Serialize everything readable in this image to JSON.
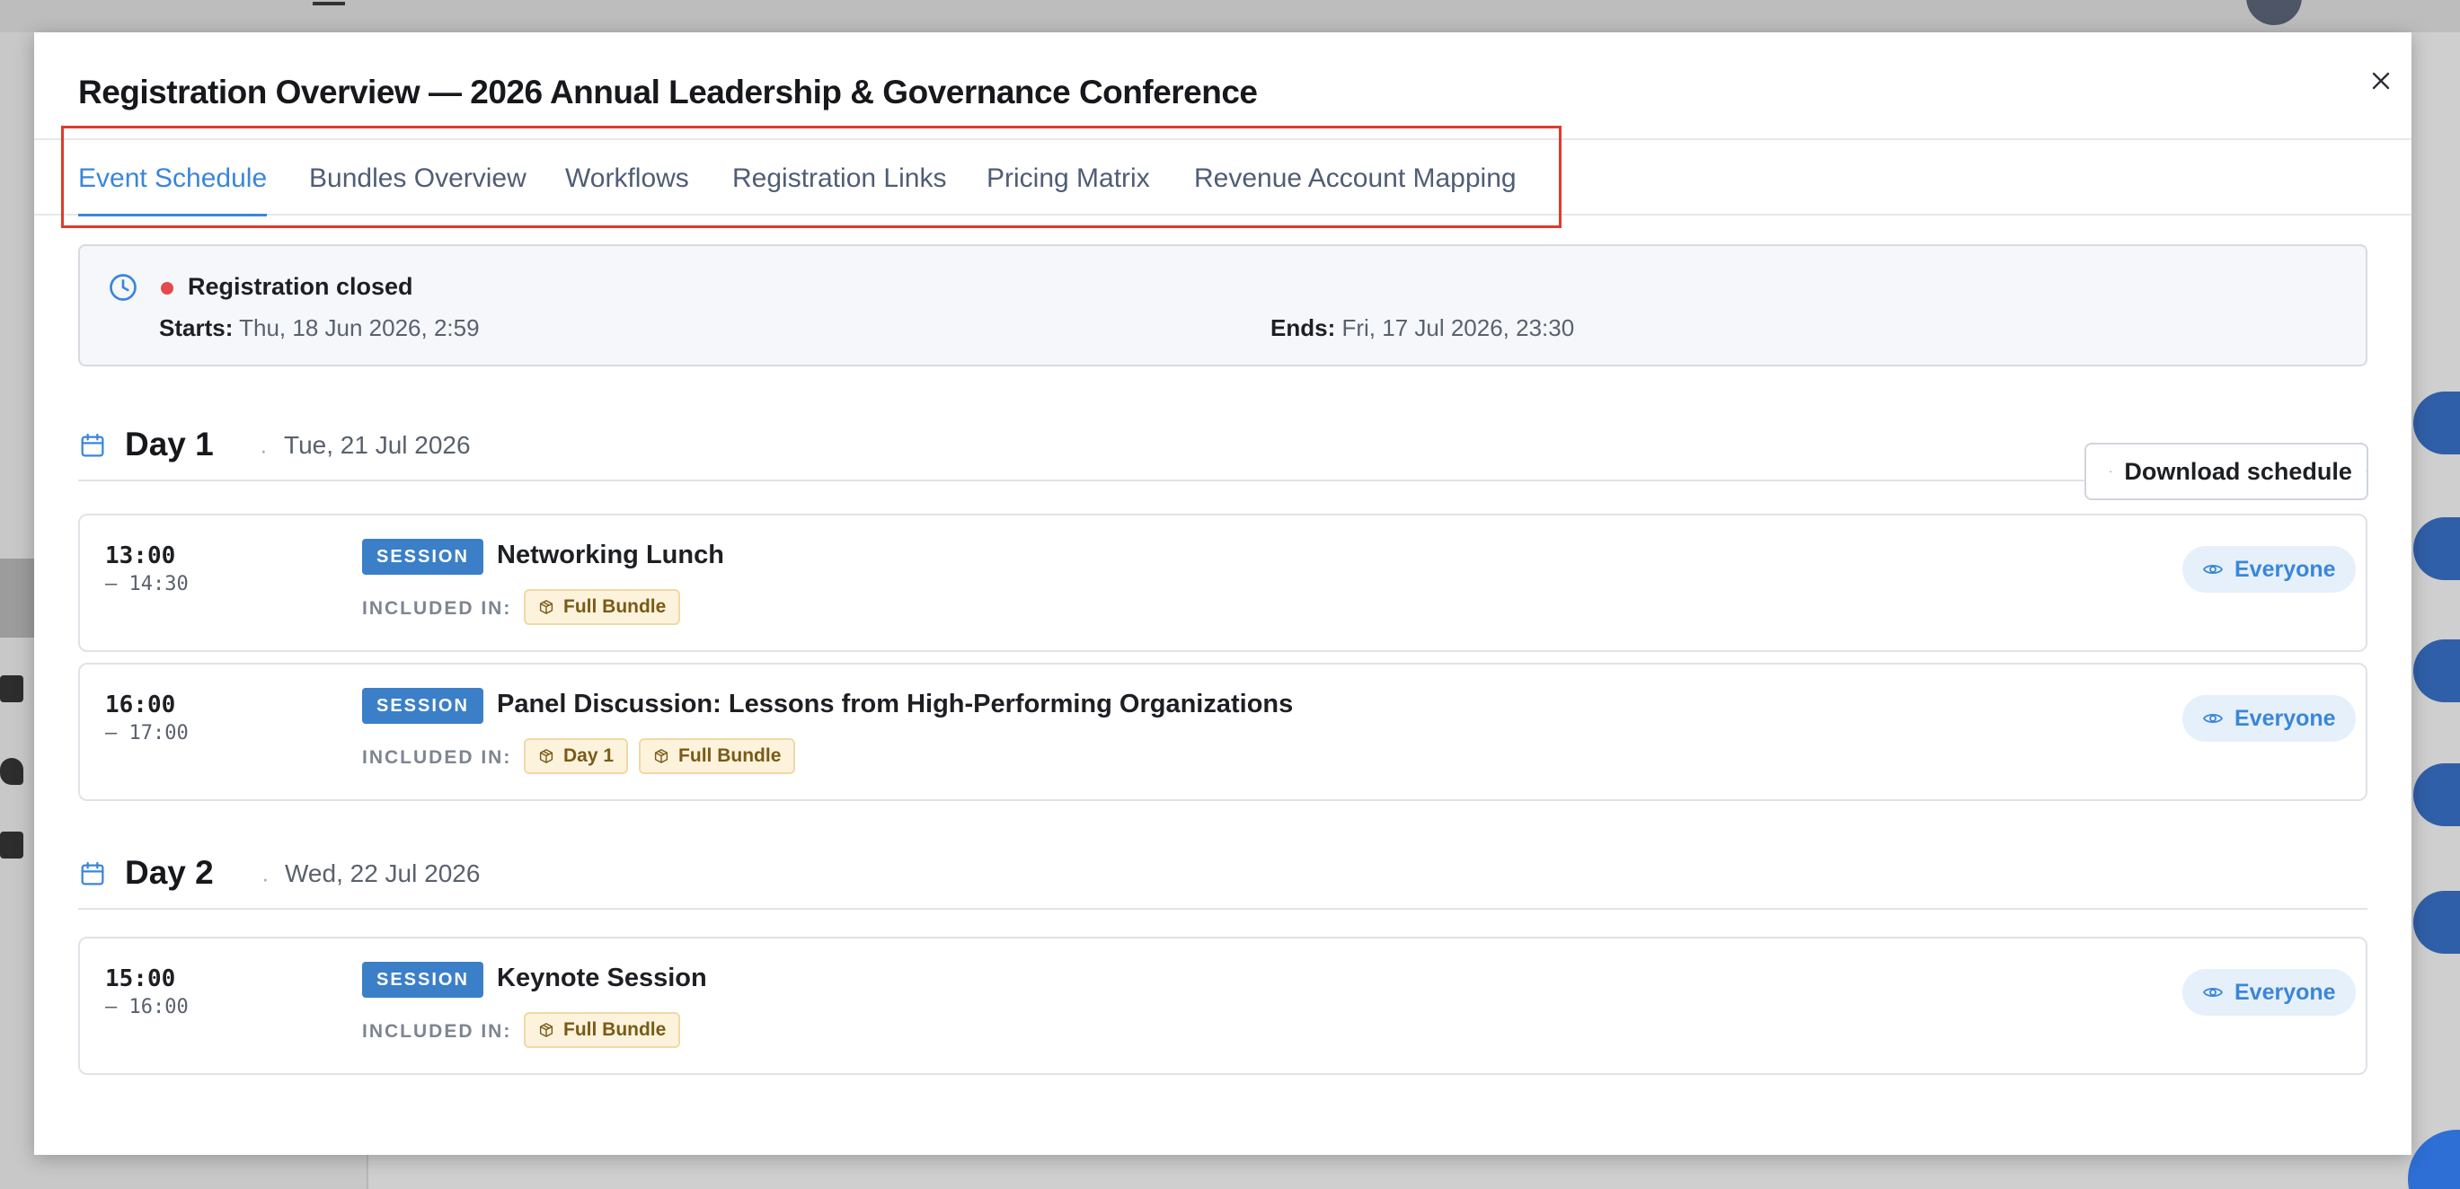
{
  "modal": {
    "title": "Registration Overview — 2026 Annual Leadership & Governance Conference"
  },
  "tabs": [
    {
      "label": "Event Schedule",
      "active": true
    },
    {
      "label": "Bundles Overview",
      "active": false
    },
    {
      "label": "Workflows",
      "active": false
    },
    {
      "label": "Registration Links",
      "active": false
    },
    {
      "label": "Pricing Matrix",
      "active": false
    },
    {
      "label": "Revenue Account Mapping",
      "active": false
    }
  ],
  "status": {
    "label": "Registration closed",
    "starts_label": "Starts:",
    "starts_value": "Thu, 18 Jun 2026, 2:59",
    "ends_label": "Ends:",
    "ends_value": "Fri, 17 Jul 2026, 23:30",
    "dot_color": "#e5484d"
  },
  "download_button": {
    "label": "Download schedule"
  },
  "days": [
    {
      "title": "Day 1",
      "date": "Tue, 21 Jul 2026",
      "sessions": [
        {
          "start": "13:00",
          "end": "– 14:30",
          "type": "SESSION",
          "title": "Networking Lunch",
          "included_label": "INCLUDED IN:",
          "bundles": [
            "Full Bundle"
          ],
          "audience": "Everyone"
        },
        {
          "start": "16:00",
          "end": "– 17:00",
          "type": "SESSION",
          "title": "Panel Discussion: Lessons from High-Performing Organizations",
          "included_label": "INCLUDED IN:",
          "bundles": [
            "Day 1",
            "Full Bundle"
          ],
          "audience": "Everyone"
        }
      ]
    },
    {
      "title": "Day 2",
      "date": "Wed, 22 Jul 2026",
      "sessions": [
        {
          "start": "15:00",
          "end": "– 16:00",
          "type": "SESSION",
          "title": "Keynote Session",
          "included_label": "INCLUDED IN:",
          "bundles": [
            "Full Bundle"
          ],
          "audience": "Everyone"
        }
      ]
    }
  ],
  "colors": {
    "accent": "#3a86d9",
    "session_badge": "#3b7fc8",
    "bundle_chip_bg": "#fdf3dc",
    "highlight_box": "#e03a2c"
  }
}
